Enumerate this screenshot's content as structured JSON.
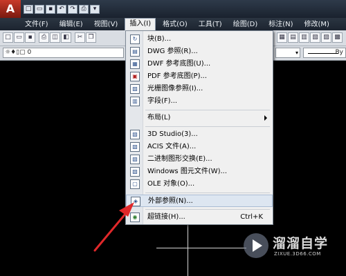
{
  "app": {
    "logo_letter": "A"
  },
  "menubar": {
    "items": [
      {
        "label": "文件(F)"
      },
      {
        "label": "编辑(E)"
      },
      {
        "label": "视图(V)"
      },
      {
        "label": "插入(I)"
      },
      {
        "label": "格式(O)"
      },
      {
        "label": "工具(T)"
      },
      {
        "label": "绘图(D)"
      },
      {
        "label": "标注(N)"
      },
      {
        "label": "修改(M)"
      }
    ],
    "active_index": 3
  },
  "toolbar": {
    "layer_value": "0",
    "linetype_suffix": "By"
  },
  "insert_menu": {
    "items": [
      {
        "label": "块(B)...",
        "icon": "block-insert-icon"
      },
      {
        "label": "DWG 参照(R)...",
        "icon": "dwg-reference-icon"
      },
      {
        "label": "DWF 参考底图(U)...",
        "icon": "dwf-underlay-icon"
      },
      {
        "label": "PDF 参考底图(P)...",
        "icon": "pdf-underlay-icon"
      },
      {
        "label": "光栅图像参照(I)...",
        "icon": "raster-image-icon"
      },
      {
        "label": "字段(F)...",
        "icon": "field-icon"
      },
      {
        "label": "布局(L)",
        "has_submenu": true
      },
      {
        "label": "3D Studio(3)...",
        "icon": "3dstudio-icon"
      },
      {
        "label": "ACIS 文件(A)...",
        "icon": "acis-file-icon"
      },
      {
        "label": "二进制图形交换(E)...",
        "icon": "binary-dxf-icon"
      },
      {
        "label": "Windows 图元文件(W)...",
        "icon": "wmf-icon"
      },
      {
        "label": "OLE 对象(O)...",
        "icon": "ole-object-icon"
      },
      {
        "label": "外部参照(N)...",
        "icon": "external-reference-icon",
        "highlighted": true
      },
      {
        "label": "超链接(H)...",
        "icon": "hyperlink-icon",
        "shortcut": "Ctrl+K"
      }
    ]
  },
  "annotation": {
    "arrow_color": "#e0282a"
  },
  "watermark": {
    "title": "溜溜自学",
    "subtitle": "ZIXUE.3D66.COM"
  }
}
